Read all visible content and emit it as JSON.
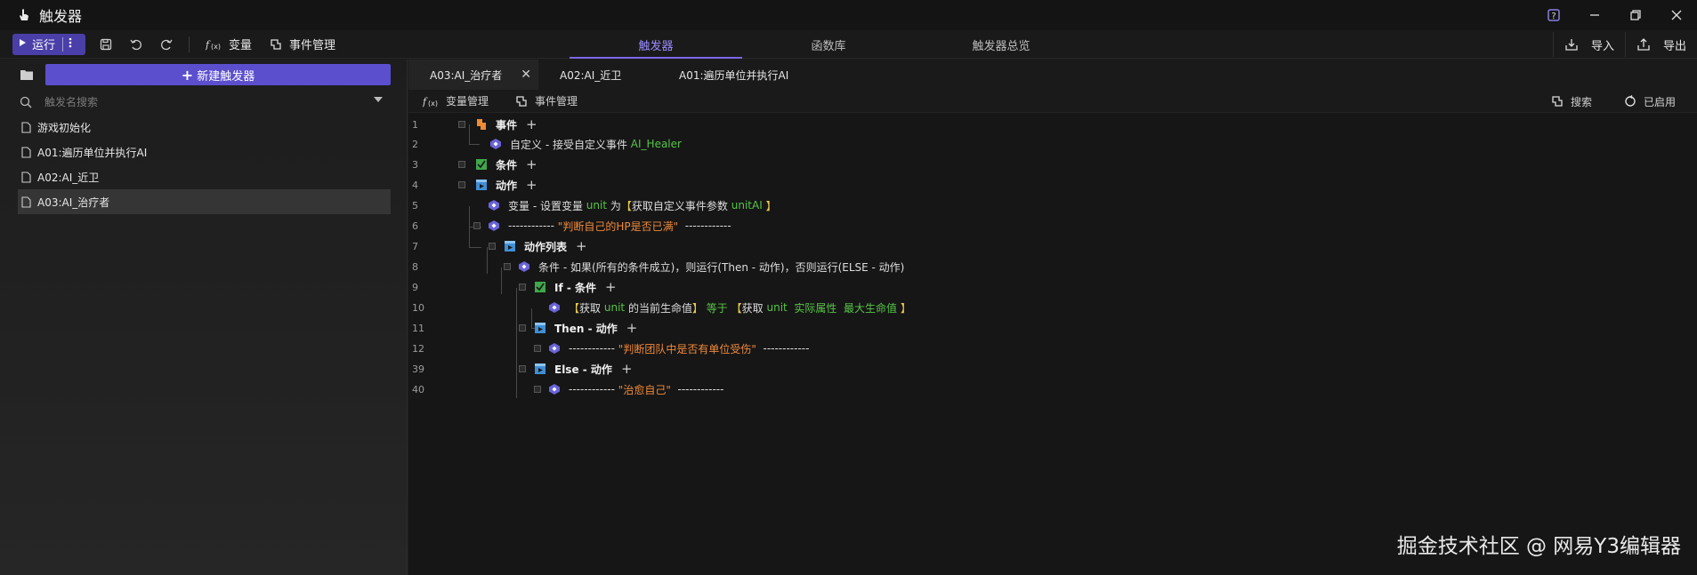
{
  "window": {
    "title": "触发器"
  },
  "toolbar": {
    "run_label": "运行",
    "variables_label": "变量",
    "event_mgmt_label": "事件管理",
    "tabs": [
      {
        "label": "触发器",
        "active": true
      },
      {
        "label": "函数库",
        "active": false
      },
      {
        "label": "触发器总览",
        "active": false
      }
    ],
    "import_label": "导入",
    "export_label": "导出",
    "accent": "#7a68f0"
  },
  "sidebar": {
    "new_trigger_label": "新建触发器",
    "search_placeholder": "触发名搜索",
    "items": [
      {
        "label": "游戏初始化",
        "selected": false
      },
      {
        "label": "A01:遍历单位并执行AI",
        "selected": false
      },
      {
        "label": "A02:AI_近卫",
        "selected": false
      },
      {
        "label": "A03:AI_治疗者",
        "selected": true
      }
    ]
  },
  "editor": {
    "tabs": [
      {
        "label": "A03:AI_治疗者",
        "active": true
      },
      {
        "label": "A02:AI_近卫",
        "active": false
      },
      {
        "label": "A01:遍历单位并执行AI",
        "active": false
      }
    ],
    "toolbar": {
      "variables_label": "变量管理",
      "event_mgmt_label": "事件管理",
      "search_label": "搜索",
      "enabled_label": "已启用"
    },
    "lines": {
      "l1": {
        "num": "1",
        "label": "事件"
      },
      "l2": {
        "num": "2",
        "text": "自定义 - 接受自定义事件",
        "arg": "AI_Healer"
      },
      "l3": {
        "num": "3",
        "label": "条件"
      },
      "l4": {
        "num": "4",
        "label": "动作"
      },
      "l5": {
        "num": "5",
        "text1": "变量 - 设置变量",
        "var": "unit",
        "text2": "为",
        "lb": "【",
        "text3": "获取自定义事件参数",
        "arg": "unitAI",
        "rb": "】"
      },
      "l6": {
        "num": "6",
        "dash1": "------------",
        "comment": "\"判断自己的HP是否已满\"",
        "dash2": "------------"
      },
      "l7": {
        "num": "7",
        "label": "动作列表"
      },
      "l8": {
        "num": "8",
        "text": "条件 - 如果(所有的条件成立)，则运行(Then - 动作)，否则运行(ELSE - 动作)"
      },
      "l9": {
        "num": "9",
        "label": "If - 条件"
      },
      "l10": {
        "num": "10",
        "lb1": "【",
        "t1": "获取",
        "v1": "unit",
        "t2": "的当前生命值",
        "rb1": "】",
        "op": "等于",
        "lb2": "【",
        "t3": "获取",
        "v2": "unit",
        "a1": "实际属性",
        "a2": "最大生命值",
        "rb2": "】"
      },
      "l11": {
        "num": "11",
        "label": "Then - 动作"
      },
      "l12": {
        "num": "12",
        "dash1": "------------",
        "comment": "\"判断团队中是否有单位受伤\"",
        "dash2": "------------"
      },
      "l39": {
        "num": "39",
        "label": "Else - 动作"
      },
      "l40": {
        "num": "40",
        "dash1": "------------",
        "comment": "\"治愈自己\"",
        "dash2": "------------"
      }
    }
  },
  "watermark": "掘金技术社区 @ 网易Y3编辑器"
}
